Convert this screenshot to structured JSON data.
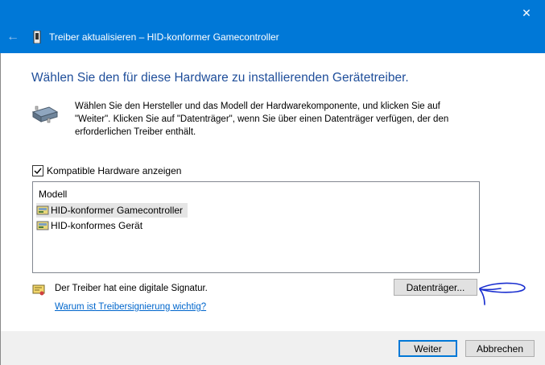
{
  "window": {
    "title": "Treiber aktualisieren – HID-konformer Gamecontroller",
    "close_glyph": "✕",
    "back_glyph": "←"
  },
  "main": {
    "heading": "Wählen Sie den für diese Hardware zu installierenden Gerätetreiber.",
    "description_line1": "Wählen Sie den Hersteller und das Modell der Hardwarekomponente, und klicken Sie auf",
    "description_line2": "\"Weiter\". Klicken Sie auf \"Datenträger\", wenn Sie über einen Datenträger verfügen, der den",
    "description_line3": "erforderlichen Treiber enthält.",
    "checkbox_label": "Kompatible Hardware anzeigen",
    "checkbox_checked": true,
    "list_header": "Modell",
    "list_items": [
      {
        "label": "HID-konformer Gamecontroller",
        "selected": true
      },
      {
        "label": "HID-konformes Gerät",
        "selected": false
      }
    ],
    "signature_text": "Der Treiber hat eine digitale Signatur.",
    "signature_link": "Warum ist Treibersignierung wichtig?",
    "disk_button": "Datenträger..."
  },
  "footer": {
    "next_button": "Weiter",
    "cancel_button": "Abbrechen"
  },
  "colors": {
    "titlebar": "#0078d7",
    "heading": "#1f4e9a",
    "link": "#0066cc",
    "annotation": "#1a2fd0"
  },
  "icons": [
    "back-arrow-icon",
    "device-manager-icon",
    "hardware-icon",
    "checkmark-icon",
    "driver-icon",
    "certificate-icon",
    "close-icon"
  ]
}
